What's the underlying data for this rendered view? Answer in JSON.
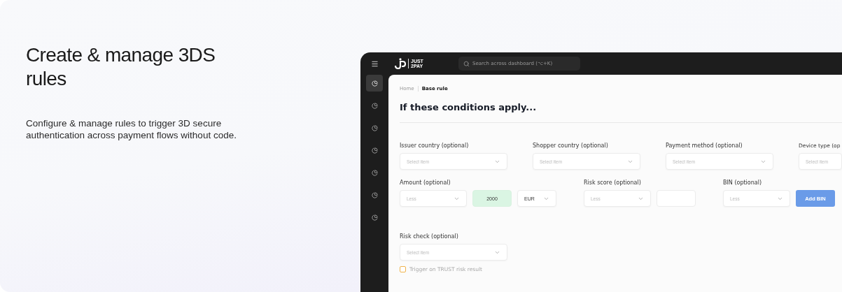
{
  "hero": {
    "title": "Create & manage 3DS rules",
    "description": "Configure & manage rules to trigger 3D secure authentication across payment flows without code."
  },
  "dashboard": {
    "logo": {
      "line_1": "JUST",
      "line_2": "2PAY"
    },
    "search": {
      "placeholder": "Search across dashboard (⌥+K)"
    },
    "sidebar": {
      "items": [
        {
          "selected": true
        },
        {
          "selected": false
        },
        {
          "selected": false
        },
        {
          "selected": false
        },
        {
          "selected": false
        },
        {
          "selected": false
        },
        {
          "selected": false
        }
      ]
    },
    "breadcrumb": [
      {
        "label": "Home",
        "current": false
      },
      {
        "label": "Base rule",
        "current": true
      }
    ],
    "heading": "If these conditions apply...",
    "rows": [
      {
        "groups": [
          {
            "label": "Issuer country (optional)",
            "controls": [
              {
                "kind": "select",
                "placeholder": "Select item"
              }
            ]
          },
          {
            "label": "Shopper country (optional)",
            "controls": [
              {
                "kind": "select",
                "placeholder": "Select item"
              }
            ]
          },
          {
            "label": "Payment method (optional)",
            "controls": [
              {
                "kind": "select",
                "placeholder": "Select item"
              }
            ]
          },
          {
            "label": "Device type (op",
            "controls": [
              {
                "kind": "select",
                "placeholder": "Select item"
              }
            ]
          }
        ]
      },
      {
        "groups": [
          {
            "label": "Amount (optional)",
            "controls": [
              {
                "kind": "select-short",
                "placeholder": "Less"
              },
              {
                "kind": "input",
                "value": "2000",
                "highlighted": true
              },
              {
                "kind": "select-value",
                "value": "EUR"
              }
            ]
          },
          {
            "label": "Risk score (optional)",
            "controls": [
              {
                "kind": "select-short",
                "placeholder": "Less"
              },
              {
                "kind": "input",
                "highlighted": false
              }
            ]
          },
          {
            "label": "BIN (optional)",
            "controls": [
              {
                "kind": "select-short",
                "placeholder": "Less"
              },
              {
                "kind": "button",
                "label": "Add BIN"
              }
            ]
          }
        ]
      },
      {
        "groups": [
          {
            "label": "Risk check (optional)",
            "controls": [
              {
                "kind": "select",
                "placeholder": "Select item"
              }
            ]
          }
        ]
      }
    ],
    "checkbox": {
      "label": "Trigger on TRUST risk result",
      "checked": false
    }
  }
}
